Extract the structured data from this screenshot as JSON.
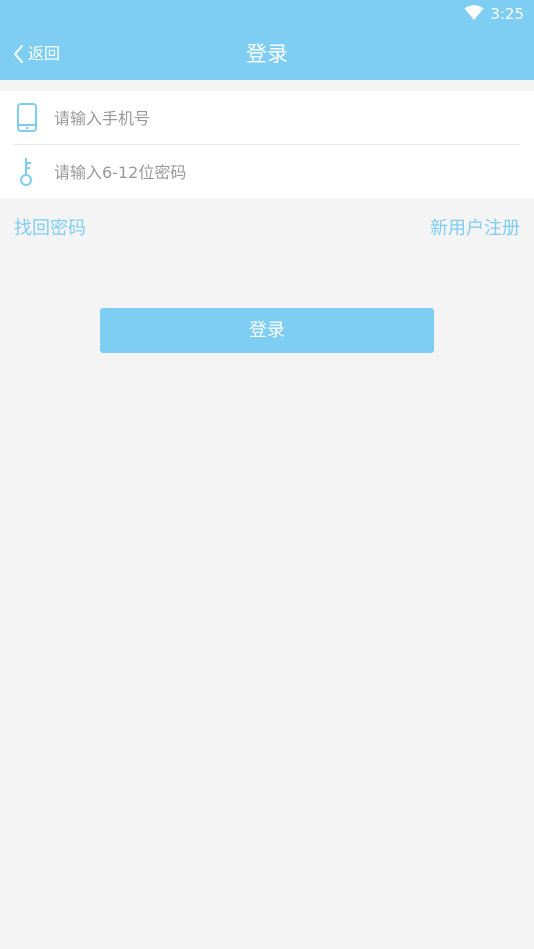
{
  "status_bar": {
    "time": "3:25",
    "wifi_icon": "wifi-icon"
  },
  "header": {
    "back_label": "返回",
    "back_icon": "chevron-left-icon",
    "title": "登录"
  },
  "form": {
    "phone": {
      "icon": "mobile-phone-icon",
      "placeholder": "请输入手机号",
      "value": ""
    },
    "password": {
      "icon": "key-icon",
      "placeholder": "请输入6-12位密码",
      "value": ""
    }
  },
  "links": {
    "forgot_password": "找回密码",
    "register": "新用户注册"
  },
  "login_button_label": "登录",
  "colors": {
    "accent": "#7ecef4",
    "background": "#f4f4f4",
    "card": "#ffffff",
    "placeholder": "#999999"
  }
}
